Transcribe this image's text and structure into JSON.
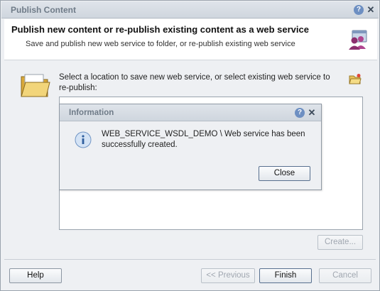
{
  "window": {
    "title": "Publish Content"
  },
  "header": {
    "title": "Publish new content or re-publish existing content as a web service",
    "subtitle": "Save and publish new web service to folder, or re-publish existing web service"
  },
  "location": {
    "instruction": "Select a location to save new web service, or select existing web service to re-publish:"
  },
  "buttons": {
    "create": "Create...",
    "help": "Help",
    "previous": "<< Previous",
    "finish": "Finish",
    "cancel": "Cancel"
  },
  "modal": {
    "title": "Information",
    "message": "WEB_SERVICE_WSDL_DEMO \\ Web service has been successfully created.",
    "close_label": "Close"
  },
  "icons": {
    "help": "?",
    "close": "✕"
  },
  "colors": {
    "titlebar_text": "#6f7b88",
    "help_icon": "#6d8fc2",
    "folder": "#e8c15a"
  }
}
